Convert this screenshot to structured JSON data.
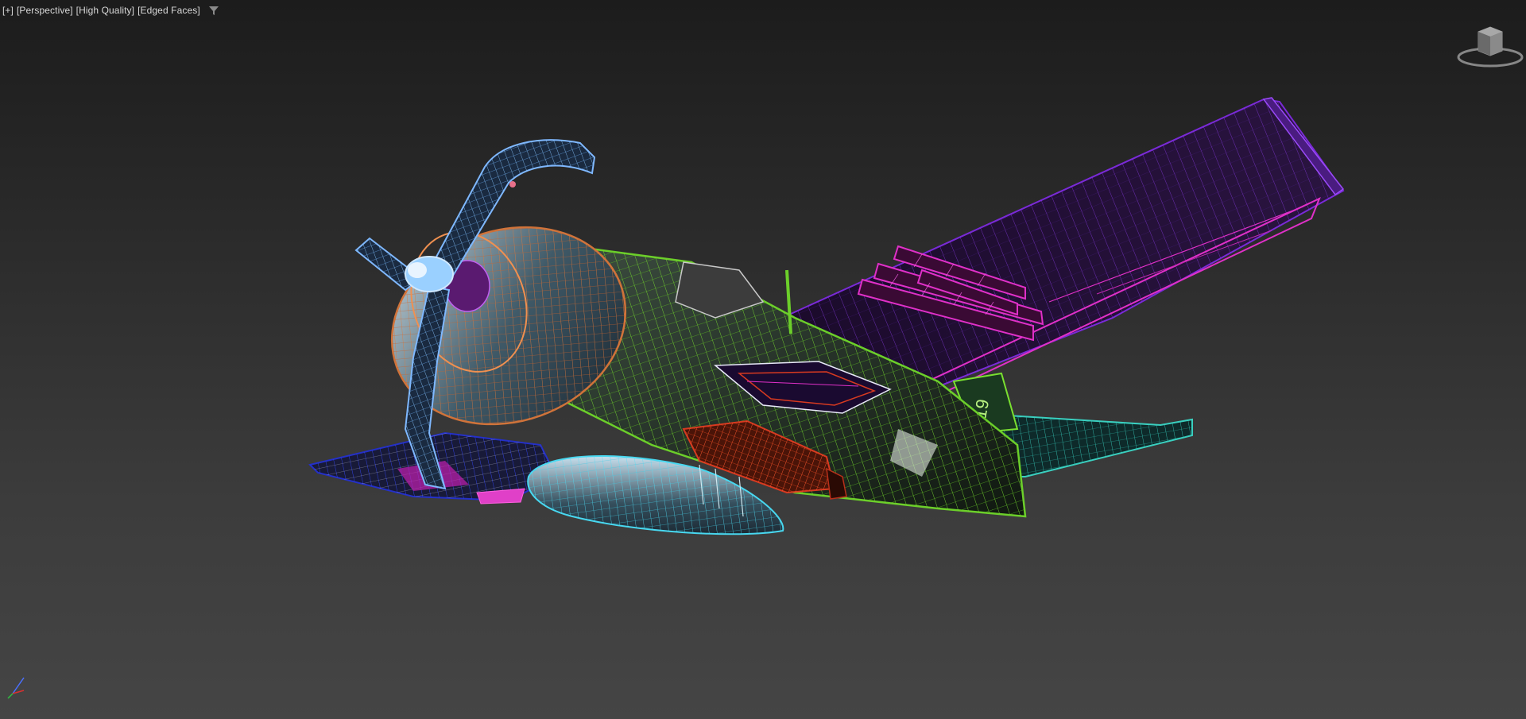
{
  "viewport": {
    "labels": {
      "plus": "[+]",
      "view": "[Perspective]",
      "quality": "[High Quality]",
      "shading": "[Edged Faces]"
    },
    "icons": {
      "filter": "filter-icon",
      "viewcube": "viewcube-icon",
      "axis": "axis-tripod-icon"
    },
    "colors": {
      "background_top": "#1c1c1c",
      "background_bottom": "#454545",
      "label_text": "#d8d8d8",
      "propeller": "#7fb8ff",
      "cowling": "#d0733a",
      "fuselage": "#6ccf2a",
      "wing_right": "#7a2ad8",
      "wing_left": "#2430c8",
      "rockets": "#e030c8",
      "drop_tank": "#48d8f0",
      "bomb": "#d83a20",
      "tail": "#3ad0c0"
    },
    "model_marking": "19"
  }
}
